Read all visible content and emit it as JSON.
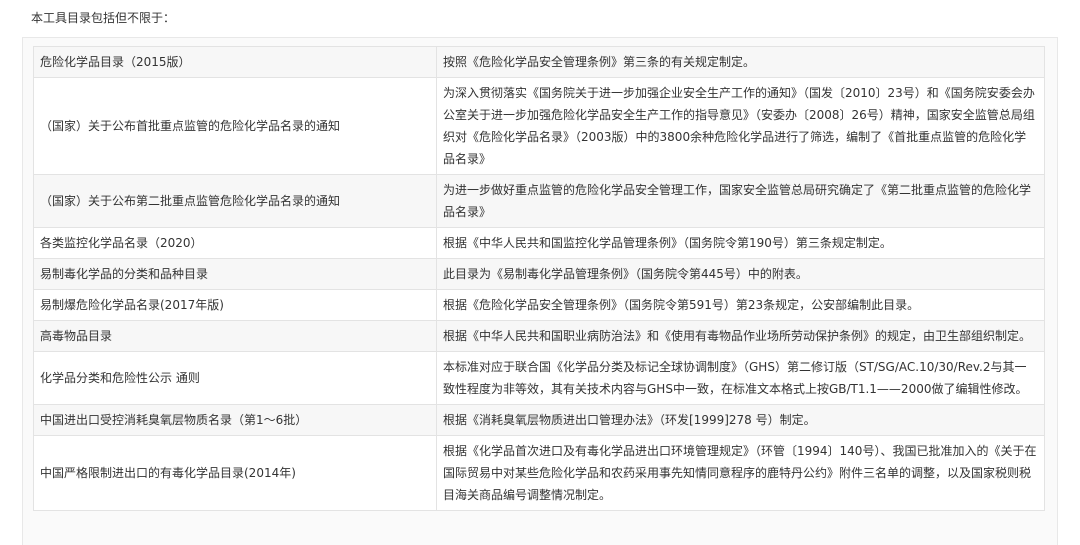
{
  "intro_text": "本工具目录包括但不限于：",
  "rows": [
    {
      "name": "危险化学品目录（2015版）",
      "desc": "按照《危险化学品安全管理条例》第三条的有关规定制定。"
    },
    {
      "name": "（国家）关于公布首批重点监管的危险化学品名录的通知",
      "desc": "为深入贯彻落实《国务院关于进一步加强企业安全生产工作的通知》（国发〔2010〕23号）和《国务院安委会办公室关于进一步加强危险化学品安全生产工作的指导意见》（安委办〔2008〕26号）精神，国家安全监管总局组织对《危险化学品名录》（2003版）中的3800余种危险化学品进行了筛选，编制了《首批重点监管的危险化学品名录》"
    },
    {
      "name": "（国家）关于公布第二批重点监管危险化学品名录的通知",
      "desc": "为进一步做好重点监管的危险化学品安全管理工作，国家安全监管总局研究确定了《第二批重点监管的危险化学品名录》"
    },
    {
      "name": "各类监控化学品名录（2020）",
      "desc": "根据《中华人民共和国监控化学品管理条例》（国务院令第190号）第三条规定制定。"
    },
    {
      "name": "易制毒化学品的分类和品种目录",
      "desc": "此目录为《易制毒化学品管理条例》（国务院令第445号）中的附表。"
    },
    {
      "name": "易制爆危险化学品名录(2017年版)",
      "desc": "根据《危险化学品安全管理条例》（国务院令第591号）第23条规定，公安部编制此目录。"
    },
    {
      "name": "高毒物品目录",
      "desc": "根据《中华人民共和国职业病防治法》和《使用有毒物品作业场所劳动保护条例》的规定，由卫生部组织制定。"
    },
    {
      "name": "化学品分类和危险性公示 通则",
      "desc": "本标准对应于联合国《化学品分类及标记全球协调制度》（GHS）第二修订版（ST/SG/AC.10/30/Rev.2与其一致性程度为非等效，其有关技术内容与GHS中一致，在标准文本格式上按GB/T1.1——2000做了编辑性修改。"
    },
    {
      "name": "中国进出口受控消耗臭氧层物质名录（第1～6批）",
      "desc": "根据《消耗臭氧层物质进出口管理办法》（环发[1999]278 号）制定。"
    },
    {
      "name": "中国严格限制进出口的有毒化学品目录(2014年)",
      "desc": "根据《化学品首次进口及有毒化学品进出口环境管理规定》（环管〔1994〕140号）、我国已批准加入的《关于在国际贸易中对某些危险化学品和农药采用事先知情同意程序的鹿特丹公约》附件三名单的调整，以及国家税则税目海关商品编号调整情况制定。"
    }
  ]
}
